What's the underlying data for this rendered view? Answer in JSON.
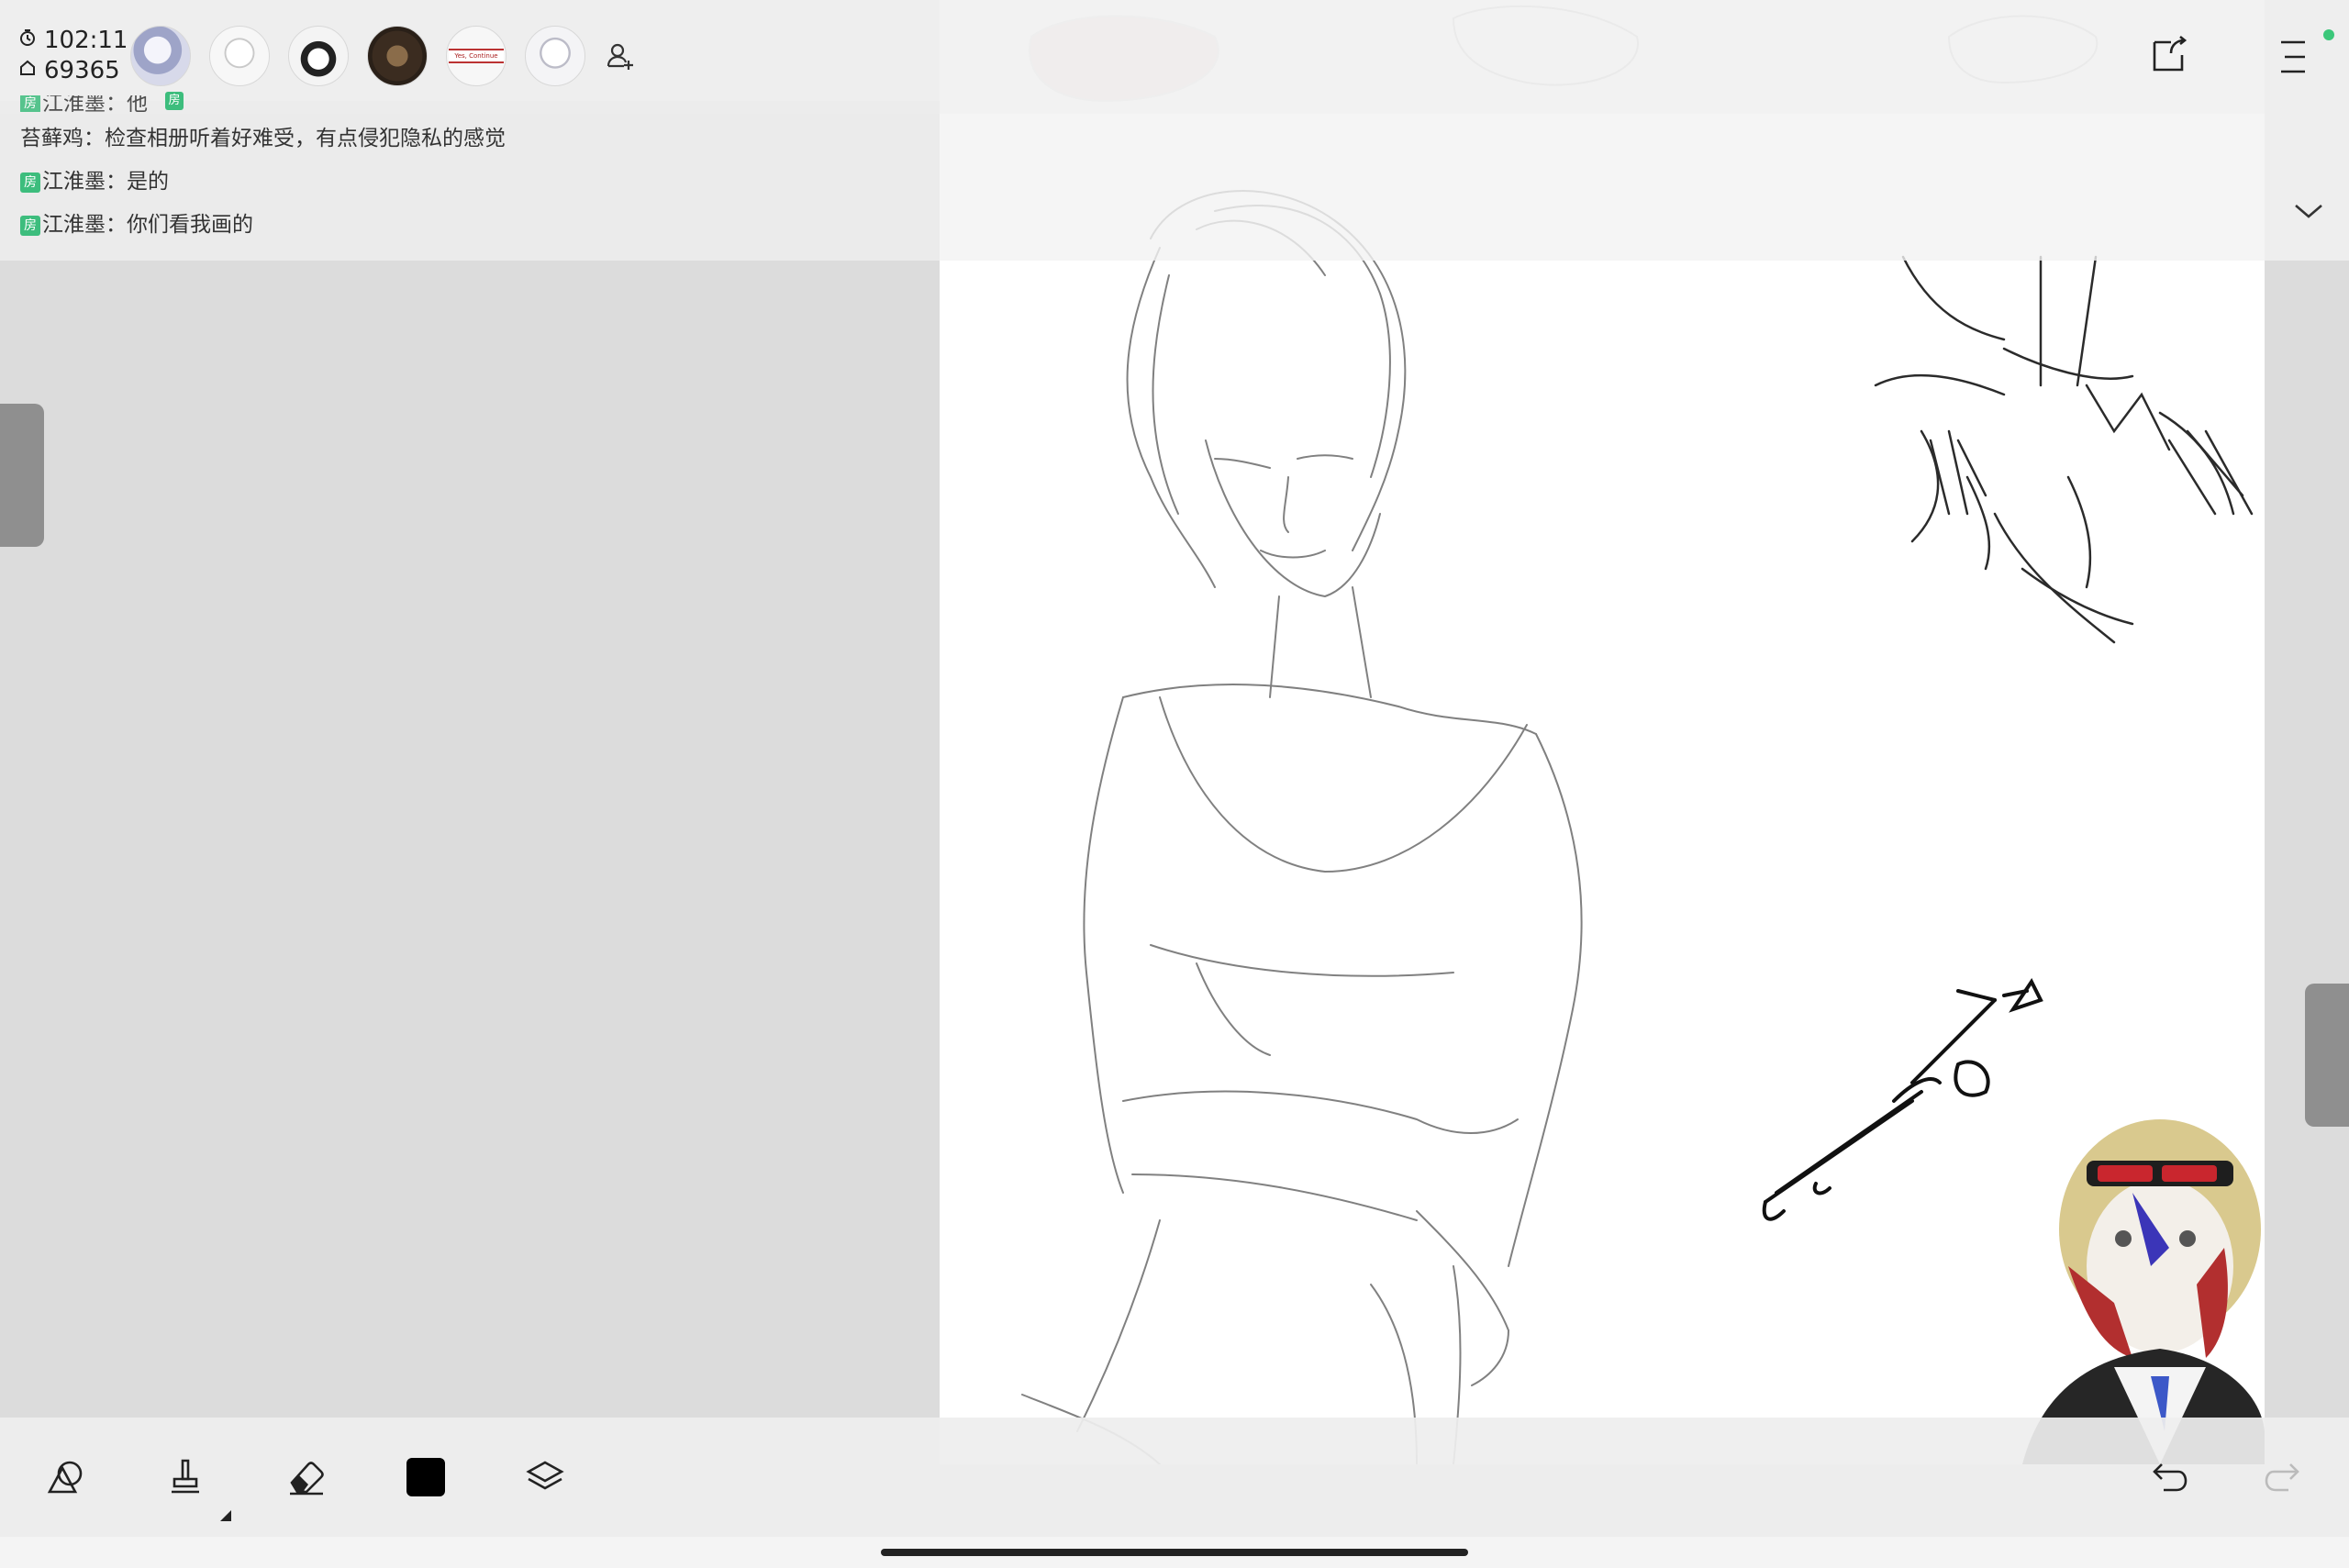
{
  "status": {
    "timer_icon": "clock-icon",
    "timer": "102:11",
    "popularity_icon": "home-icon",
    "popularity": "69365"
  },
  "participants": {
    "count_visible": 6,
    "room_badge": "房",
    "thumbnail_text": "Yes, Continue",
    "add_icon": "add-user-icon"
  },
  "chat": {
    "messages": [
      {
        "badge": "房",
        "name": "江淮墨",
        "text": "他",
        "truncated": true
      },
      {
        "badge": "",
        "name": "苔藓鸡",
        "text": "检查相册听着好难受，有点侵犯隐私的感觉"
      },
      {
        "badge": "房",
        "name": "江淮墨",
        "text": "是的"
      },
      {
        "badge": "房",
        "name": "江淮墨",
        "text": "你们看我画的"
      }
    ],
    "separator": "："
  },
  "top_right": {
    "share_icon": "share-image-icon",
    "menu_icon": "hamburger-menu-icon",
    "collapse_icon": "chevron-down-icon"
  },
  "toolbar": {
    "tools": [
      "shape-tool-icon",
      "brush-tool-icon",
      "eraser-tool-icon",
      "color-swatch",
      "layers-icon"
    ],
    "current_color": "#000000",
    "undo_icon": "undo-icon",
    "redo_icon": "redo-icon"
  }
}
